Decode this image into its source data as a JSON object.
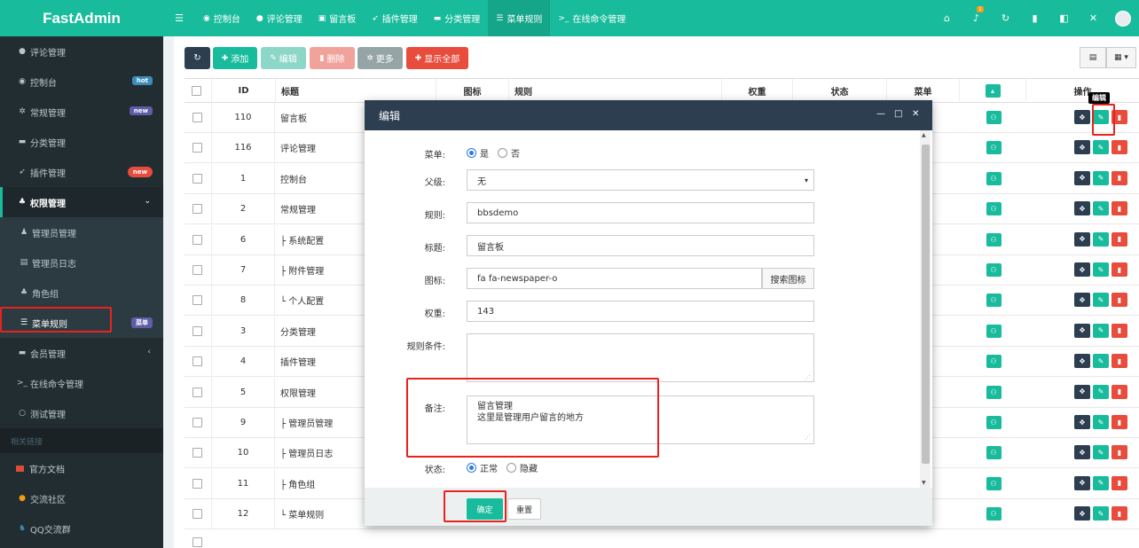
{
  "app": {
    "logo": "FastAdmin"
  },
  "sidebar": {
    "items": [
      {
        "label": "评论管理",
        "icon": "comment-icon"
      },
      {
        "label": "控制台",
        "icon": "dashboard-icon",
        "badge": "hot"
      },
      {
        "label": "常规管理",
        "icon": "cogs-icon",
        "badge": "new"
      },
      {
        "label": "分类管理",
        "icon": "list-icon"
      },
      {
        "label": "插件管理",
        "icon": "rocket-icon",
        "badge": "new"
      },
      {
        "label": "权限管理",
        "icon": "group-icon"
      },
      {
        "label": "管理员管理",
        "icon": "user-icon"
      },
      {
        "label": "管理员日志",
        "icon": "list-alt-icon"
      },
      {
        "label": "角色组",
        "icon": "group-icon"
      },
      {
        "label": "菜单规则",
        "icon": "bars-icon",
        "badge": "菜单"
      },
      {
        "label": "会员管理",
        "icon": "list-icon"
      },
      {
        "label": "在线命令管理",
        "icon": "terminal-icon"
      },
      {
        "label": "测试管理",
        "icon": "circle-icon"
      }
    ],
    "header": "相关链接",
    "links": [
      {
        "label": "官方文档",
        "icon": "square-icon",
        "color": "#dd4b39"
      },
      {
        "label": "交流社区",
        "icon": "comment-icon",
        "color": "#f39c12"
      },
      {
        "label": "QQ交流群",
        "icon": "qq-icon",
        "color": "#3c8dbc"
      }
    ]
  },
  "navbar": {
    "tabs": [
      {
        "label": "控制台",
        "icon": "dashboard-icon"
      },
      {
        "label": "评论管理",
        "icon": "comment-icon"
      },
      {
        "label": "留言板",
        "icon": "newspaper-icon"
      },
      {
        "label": "插件管理",
        "icon": "rocket-icon"
      },
      {
        "label": "分类管理",
        "icon": "list-icon"
      },
      {
        "label": "菜单规则",
        "icon": "bars-icon"
      },
      {
        "label": "在线命令管理",
        "icon": "terminal-icon"
      }
    ],
    "notification_count": "1"
  },
  "toolbar": {
    "add": "添加",
    "edit": "编辑",
    "delete": "删除",
    "more": "更多",
    "show_all": "显示全部"
  },
  "table": {
    "headers": {
      "id": "ID",
      "title": "标题",
      "icon": "图标",
      "rule": "规则",
      "weigh": "权重",
      "status": "状态",
      "menu": "菜单",
      "operate": "操作"
    },
    "rows": [
      {
        "id": "110",
        "title": "留言板"
      },
      {
        "id": "116",
        "title": "评论管理"
      },
      {
        "id": "1",
        "title": "控制台"
      },
      {
        "id": "2",
        "title": "常规管理"
      },
      {
        "id": "6",
        "title": "├ 系统配置"
      },
      {
        "id": "7",
        "title": "├ 附件管理"
      },
      {
        "id": "8",
        "title": "└ 个人配置"
      },
      {
        "id": "3",
        "title": "分类管理"
      },
      {
        "id": "4",
        "title": "插件管理"
      },
      {
        "id": "5",
        "title": "权限管理"
      },
      {
        "id": "9",
        "title": "├ 管理员管理"
      },
      {
        "id": "10",
        "title": "├ 管理员日志"
      },
      {
        "id": "11",
        "title": "├ 角色组"
      },
      {
        "id": "12",
        "title": "└ 菜单规则"
      }
    ],
    "tooltip": "编辑"
  },
  "modal": {
    "title": "编辑",
    "menu_label": "菜单:",
    "menu_yes": "是",
    "menu_no": "否",
    "parent_label": "父级:",
    "parent_value": "无",
    "rule_label": "规则:",
    "rule_value": "bbsdemo",
    "title_label": "标题:",
    "title_value": "留言板",
    "icon_label": "图标:",
    "icon_value": "fa fa-newspaper-o",
    "icon_search": "搜索图标",
    "weigh_label": "权重:",
    "weigh_value": "143",
    "condition_label": "规则条件:",
    "remark_label": "备注:",
    "remark_line1": "留言管理",
    "remark_line2": "这里是管理用户留言的地方",
    "status_label": "状态:",
    "status_normal": "正常",
    "status_hidden": "隐藏",
    "ok": "确定",
    "reset": "重置"
  }
}
